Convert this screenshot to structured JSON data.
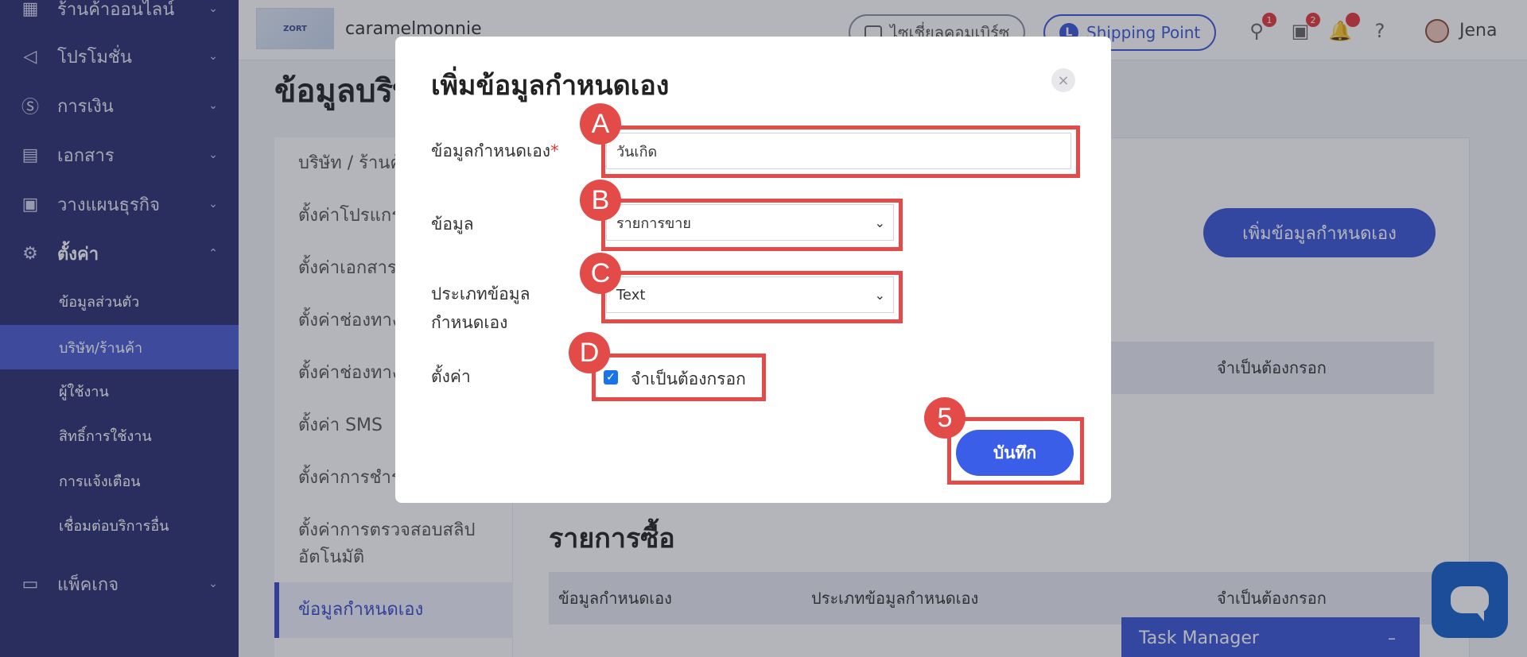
{
  "sidebar": {
    "items": [
      {
        "label": "ร้านค้าออนไลน์",
        "icon": "store-icon"
      },
      {
        "label": "โปรโมชั่น",
        "icon": "megaphone-icon"
      },
      {
        "label": "การเงิน",
        "icon": "dollar-icon"
      },
      {
        "label": "เอกสาร",
        "icon": "document-icon"
      },
      {
        "label": "วางแผนธุรกิจ",
        "icon": "business-plan-icon"
      },
      {
        "label": "ตั้งค่า",
        "icon": "gear-icon"
      },
      {
        "label": "แพ็คเกจ",
        "icon": "briefcase-icon"
      }
    ],
    "sub_items": [
      "ข้อมูลส่วนตัว",
      "บริษัท/ร้านค้า",
      "ผู้ใช้งาน",
      "สิทธิ์การใช้งาน",
      "การแจ้งเตือน",
      "เชื่อมต่อบริการอื่น"
    ]
  },
  "topbar": {
    "logo_text": "ZORT",
    "shop_name": "caramelmonnie",
    "pill_1": "ไซเชี่ยลคอมเบิร์ซ",
    "pill_2": "Shipping Point",
    "pill_2_letter": "L",
    "badge_1": "1",
    "badge_2": "2",
    "user_name": "Jena"
  },
  "page": {
    "title": "ข้อมูลบริษัท",
    "menu": [
      "บริษัท / ร้านค้า",
      "ตั้งค่าโปรแกรม",
      "ตั้งค่าเอกสาร",
      "ตั้งค่าช่องทาง",
      "ตั้งค่าช่องทาง",
      "ตั้งค่า SMS",
      "ตั้งค่าการชำระ",
      "ตั้งค่าการตรวจสอบสลิป",
      "อัตโนมัติ",
      "ข้อมูลกำหนดเอง"
    ],
    "add_button": "เพิ่มข้อมูลกำหนดเอง",
    "table1_col": "จำเป็นต้องกรอก",
    "section_title": "รายการซื้อ",
    "table2_cols": [
      "ข้อมูลกำหนดเอง",
      "ประเภทข้อมูลกำหนดเอง",
      "จำเป็นต้องกรอก"
    ],
    "task_manager": "Task Manager",
    "task_manager_toggle": "–"
  },
  "modal": {
    "title": "เพิ่มข้อมูลกำหนดเอง",
    "close": "×",
    "field_label": "ข้อมูลกำหนดเอง",
    "field_required": "*",
    "field_value": "วันเกิด",
    "data_label": "ข้อมูล",
    "data_value": "รายการขาย",
    "type_label_1": "ประเภทข้อมูล",
    "type_label_2": "กำหนดเอง",
    "type_value": "Text",
    "setting_label": "ตั้งค่า",
    "required_checkbox_label": "จำเป็นต้องกรอก",
    "required_checked": true,
    "save_button": "บันทึก",
    "caret": "⌄"
  },
  "annotations": {
    "markers": [
      "A",
      "B",
      "C",
      "D",
      "5"
    ],
    "color": "#e34b48"
  }
}
